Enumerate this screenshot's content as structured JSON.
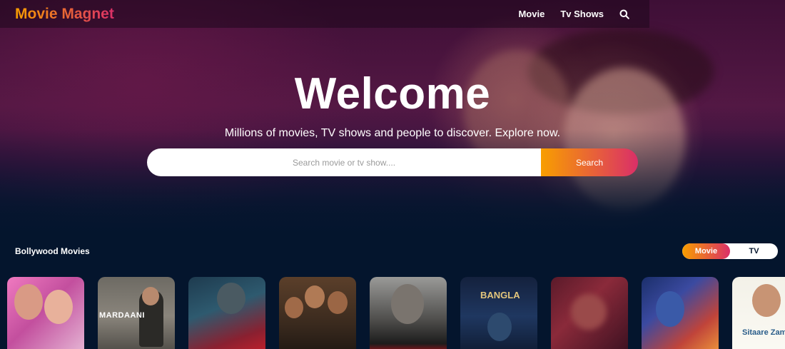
{
  "app": {
    "logo": "Movie Magnet"
  },
  "nav": {
    "items": [
      "Movie",
      "Tv Shows"
    ],
    "search_icon": "search-icon"
  },
  "hero": {
    "title": "Welcome",
    "subtitle": "Millions of movies, TV shows and people to discover. Explore now.",
    "search": {
      "placeholder": "Search movie or tv show....",
      "value": "",
      "button_label": "Search"
    }
  },
  "section": {
    "title": "Bollywood Movies",
    "switch": {
      "tabs": [
        "Movie",
        "TV"
      ],
      "active": "Movie"
    }
  },
  "posters": [
    {
      "caption": ""
    },
    {
      "caption": "MARDAANI"
    },
    {
      "caption": ""
    },
    {
      "caption": ""
    },
    {
      "caption": ""
    },
    {
      "caption": "BANGLA"
    },
    {
      "caption": ""
    },
    {
      "caption": ""
    },
    {
      "caption": "Sitaare Zameen"
    }
  ],
  "colors": {
    "accent_start": "#f89e00",
    "accent_end": "#da2f68",
    "background": "#04152d"
  }
}
